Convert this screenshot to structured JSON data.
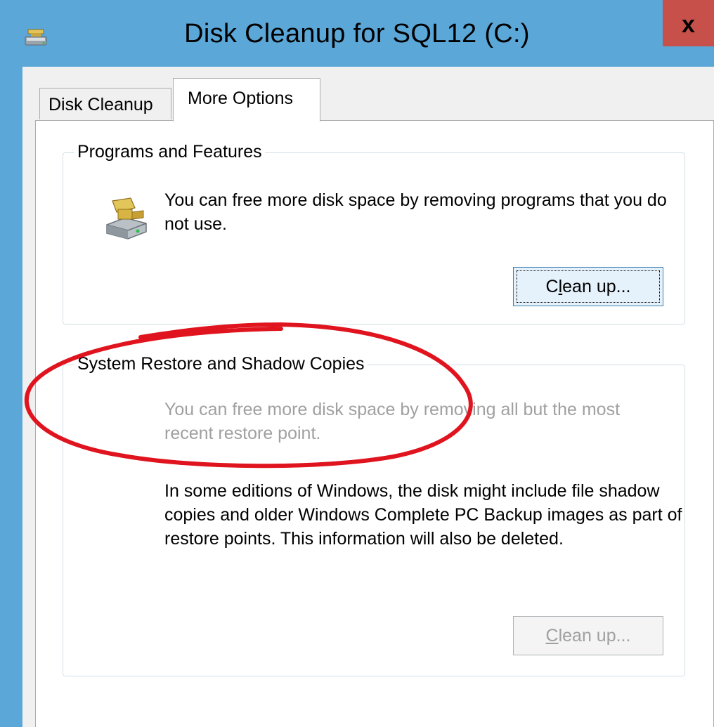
{
  "window": {
    "title": "Disk Cleanup for SQL12 (C:)",
    "close_label": "x"
  },
  "tabs": [
    {
      "label": "Disk Cleanup",
      "active": false
    },
    {
      "label": "More Options",
      "active": true
    }
  ],
  "programs_group": {
    "legend": "Programs and Features",
    "description": "You can free more disk space by removing programs that you do not use.",
    "button": {
      "prefix": "C",
      "accel": "l",
      "suffix": "ean up...",
      "enabled": true
    },
    "icon": "programs-drive-icon"
  },
  "restore_group": {
    "legend": "System Restore and Shadow Copies",
    "description": "You can free more disk space by removing all but the most recent restore point.",
    "note": "In some editions of Windows, the disk might include file shadow copies and older Windows Complete PC Backup images as part of restore points. This information will also be deleted.",
    "button": {
      "prefix": "",
      "accel": "C",
      "suffix": "lean up...",
      "enabled": false
    }
  },
  "colors": {
    "titlebar": "#5ba7d8",
    "close_button": "#c7504a",
    "annotation": "#e0141e",
    "disabled_text": "#a0a0a0"
  },
  "annotation": {
    "shape": "hand-drawn-ellipse",
    "target": "restore_group"
  }
}
